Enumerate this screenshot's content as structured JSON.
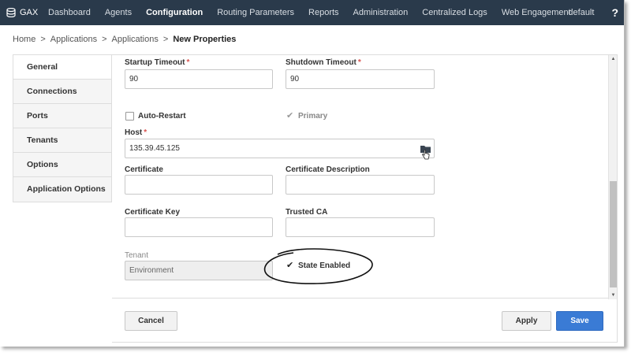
{
  "topnav": {
    "brand": "GAX",
    "items": [
      {
        "label": "Dashboard"
      },
      {
        "label": "Agents"
      },
      {
        "label": "Configuration",
        "active": true
      },
      {
        "label": "Routing Parameters"
      },
      {
        "label": "Reports"
      },
      {
        "label": "Administration"
      },
      {
        "label": "Centralized Logs"
      },
      {
        "label": "Web Engagement"
      }
    ],
    "user": "default",
    "help": "?"
  },
  "breadcrumb": [
    "Home",
    "Applications",
    "Applications",
    "New Properties"
  ],
  "breadcrumb_separator": ">",
  "sidebar": {
    "items": [
      {
        "label": "General",
        "active": true
      },
      {
        "label": "Connections"
      },
      {
        "label": "Ports"
      },
      {
        "label": "Tenants"
      },
      {
        "label": "Options"
      },
      {
        "label": "Application Options"
      }
    ]
  },
  "form": {
    "required_mark": "*",
    "startup_timeout": {
      "label": "Startup Timeout",
      "value": "90"
    },
    "shutdown_timeout": {
      "label": "Shutdown Timeout",
      "value": "90"
    },
    "auto_restart": {
      "label": "Auto-Restart",
      "checked": false
    },
    "primary": {
      "label": "Primary",
      "checked": true,
      "disabled": true
    },
    "host": {
      "label": "Host",
      "value": "135.39.45.125"
    },
    "certificate": {
      "label": "Certificate",
      "value": ""
    },
    "certificate_description": {
      "label": "Certificate Description",
      "value": ""
    },
    "certificate_key": {
      "label": "Certificate Key",
      "value": ""
    },
    "trusted_ca": {
      "label": "Trusted CA",
      "value": ""
    },
    "tenant": {
      "label": "Tenant",
      "value": "Environment"
    },
    "state_enabled": {
      "label": "State Enabled",
      "checked": true
    },
    "checkmark_glyph": "✔"
  },
  "footer": {
    "cancel_label": "Cancel",
    "apply_label": "Apply",
    "save_label": "Save"
  },
  "colors": {
    "nav_bg": "#2a3a4b",
    "primary_button": "#3a7bd5",
    "required": "#d9534f"
  }
}
